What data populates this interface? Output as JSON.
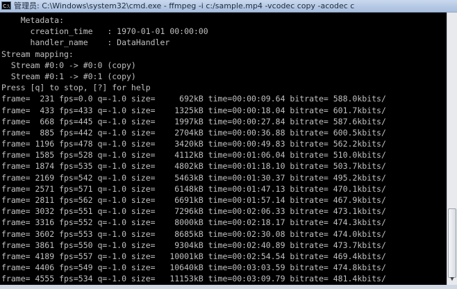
{
  "window": {
    "icon_label": "C:\\",
    "title": "管理员: C:\\Windows\\system32\\cmd.exe - ffmpeg  -i c:/sample.mp4 -vcodec copy -acodec c"
  },
  "icons": {
    "app": "cmd-icon",
    "scroll_down": "arrow-down-icon"
  },
  "console": {
    "lines": [
      "    Metadata:",
      "      creation_time   : 1970-01-01 00:00:00",
      "      handler_name    : DataHandler",
      "Stream mapping:",
      "  Stream #0:0 -> #0:0 (copy)",
      "  Stream #0:1 -> #0:1 (copy)",
      "Press [q] to stop, [?] for help",
      "frame=  231 fps=0.0 q=-1.0 size=     692kB time=00:00:09.64 bitrate= 588.0kbits/",
      "frame=  433 fps=433 q=-1.0 size=    1325kB time=00:00:18.04 bitrate= 601.7kbits/",
      "frame=  668 fps=445 q=-1.0 size=    1997kB time=00:00:27.84 bitrate= 587.6kbits/",
      "frame=  885 fps=442 q=-1.0 size=    2704kB time=00:00:36.88 bitrate= 600.5kbits/",
      "frame= 1196 fps=478 q=-1.0 size=    3420kB time=00:00:49.83 bitrate= 562.2kbits/",
      "frame= 1585 fps=528 q=-1.0 size=    4112kB time=00:01:06.04 bitrate= 510.0kbits/",
      "frame= 1874 fps=535 q=-1.0 size=    4802kB time=00:01:18.10 bitrate= 503.7kbits/",
      "frame= 2169 fps=542 q=-1.0 size=    5463kB time=00:01:30.37 bitrate= 495.2kbits/",
      "frame= 2571 fps=571 q=-1.0 size=    6148kB time=00:01:47.13 bitrate= 470.1kbits/",
      "frame= 2811 fps=562 q=-1.0 size=    6691kB time=00:01:57.14 bitrate= 467.9kbits/",
      "frame= 3032 fps=551 q=-1.0 size=    7296kB time=00:02:06.33 bitrate= 473.1kbits/",
      "frame= 3316 fps=552 q=-1.0 size=    8000kB time=00:02:18.17 bitrate= 474.3kbits/",
      "frame= 3602 fps=553 q=-1.0 size=    8685kB time=00:02:30.08 bitrate= 474.0kbits/",
      "frame= 3861 fps=550 q=-1.0 size=    9304kB time=00:02:40.89 bitrate= 473.7kbits/",
      "frame= 4189 fps=557 q=-1.0 size=   10001kB time=00:02:54.54 bitrate= 469.4kbits/",
      "frame= 4406 fps=549 q=-1.0 size=   10640kB time=00:03:03.59 bitrate= 474.8kbits/",
      "frame= 4555 fps=534 q=-1.0 size=   11153kB time=00:03:09.79 bitrate= 481.4kbits/"
    ]
  },
  "colors": {
    "console_bg": "#000000",
    "console_text": "#c0c0c0",
    "titlebar": "#b4c8e3"
  }
}
